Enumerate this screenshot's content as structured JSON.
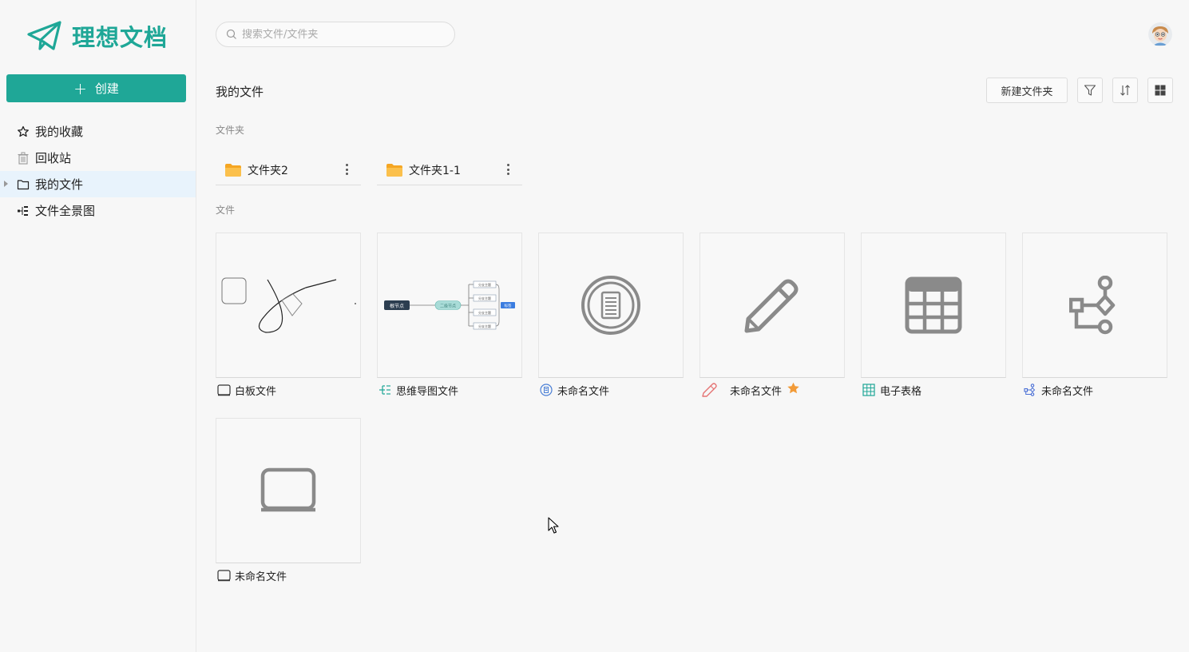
{
  "app": {
    "title": "理想文档",
    "create_label": "创建",
    "brand_color": "#1fa797"
  },
  "sidebar": {
    "items": [
      {
        "label": "我的收藏",
        "icon": "star-outline-icon"
      },
      {
        "label": "回收站",
        "icon": "trash-icon"
      },
      {
        "label": "我的文件",
        "icon": "folder-outline-icon",
        "active": true
      },
      {
        "label": "文件全景图",
        "icon": "tree-icon"
      }
    ]
  },
  "search": {
    "placeholder": "搜索文件/文件夹"
  },
  "main": {
    "title": "我的文件",
    "new_folder_label": "新建文件夹",
    "folders_label": "文件夹",
    "files_label": "文件",
    "folders": [
      {
        "name": "文件夹2"
      },
      {
        "name": "文件夹1-1"
      }
    ],
    "files": [
      {
        "name": "白板文件",
        "type": "whiteboard",
        "icon": "whiteboard-icon"
      },
      {
        "name": "思维导图文件",
        "type": "mindmap",
        "icon": "mindmap-icon",
        "preview": {
          "root": "根节点",
          "center": "二级节点",
          "branches": [
            "分支主题",
            "分支主题",
            "分支主题",
            "分支主题"
          ],
          "tag": "标签"
        }
      },
      {
        "name": "未命名文件",
        "type": "document",
        "icon": "document-circle-icon"
      },
      {
        "name": "未命名文件",
        "type": "rich-text",
        "icon": "pencil-icon",
        "starred": true
      },
      {
        "name": "电子表格",
        "type": "spreadsheet",
        "icon": "table-icon"
      },
      {
        "name": "未命名文件",
        "type": "flowchart",
        "icon": "flowchart-icon"
      },
      {
        "name": "未命名文件",
        "type": "whiteboard",
        "icon": "whiteboard-icon"
      }
    ]
  }
}
